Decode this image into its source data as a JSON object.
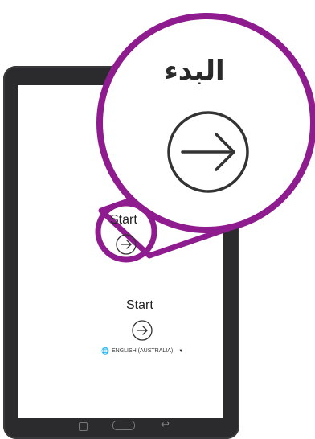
{
  "callout": {
    "title": "البدء",
    "ring_color": "#8e1c8e"
  },
  "screen": {
    "start_label": "Start",
    "language_label": "ENGLISH (AUSTRALIA)"
  },
  "icons": {
    "start": "arrow-right-circle-icon",
    "language": "globe-icon",
    "dropdown": "caret-down-icon",
    "nav_recent": "recent-apps-icon",
    "nav_home": "home-button-icon",
    "nav_back": "back-icon"
  },
  "colors": {
    "accent": "#8e1c8e",
    "tablet_frame": "#2b2b2d",
    "screen": "#ffffff"
  }
}
